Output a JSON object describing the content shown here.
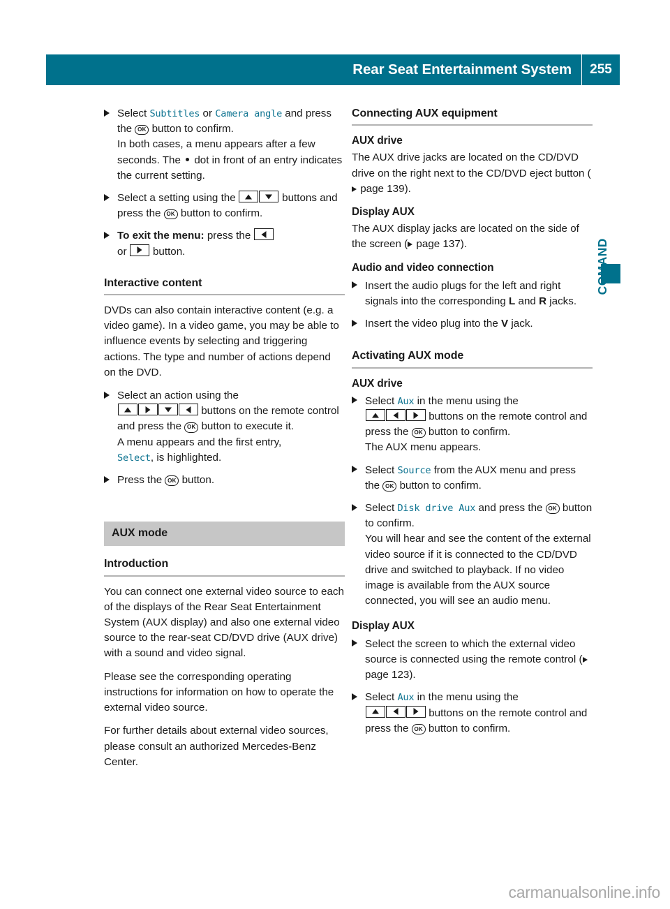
{
  "header": {
    "title": "Rear Seat Entertainment System",
    "page_number": "255"
  },
  "side_tab": {
    "label": "COMAND"
  },
  "watermark": {
    "text": "carmanualsonline.info"
  },
  "left_column": {
    "step_subtitles": {
      "lead": "Select ",
      "term1": "Subtitles",
      "mid": " or ",
      "term2": "Camera angle",
      "tail": " and press the ",
      "ok": "OK",
      "tail2": " button to confirm.",
      "cont1a": "In both cases, a menu appears after a few seconds. The ",
      "cont1b": " dot in front of an entry indicates the current setting."
    },
    "step_setting": {
      "lead": "Select a setting using the ",
      "mid": " buttons and press the ",
      "ok": "OK",
      "tail": " button to confirm."
    },
    "step_exit": {
      "bold": "To exit the menu:",
      "lead": " press the ",
      "mid": " or ",
      "tail": " button."
    },
    "interactive": {
      "heading": "Interactive content",
      "paragraph": "DVDs can also contain interactive content (e.g. a video game). In a video game, you may be able to influence events by selecting and triggering actions. The type and number of actions depend on the DVD.",
      "step_action": {
        "lead": "Select an action using the",
        "mid": " buttons on the remote control and press the ",
        "ok": "OK",
        "tail": " button to execute it.",
        "cont": "A menu appears and the first entry, ",
        "term": "Select",
        "cont2": ", is highlighted."
      },
      "step_press": {
        "lead": "Press the ",
        "ok": "OK",
        "tail": " button."
      }
    },
    "aux_mode": {
      "band_title": "AUX mode",
      "intro_heading": "Introduction",
      "paragraph1": "You can connect one external video source to each of the displays of the Rear Seat Entertainment System (AUX display) and also one external video source to the rear-seat CD/DVD drive (AUX drive) with a sound and video signal.",
      "paragraph2": "Please see the corresponding operating instructions for information on how to operate the external video source.",
      "paragraph3": "For further details about external video sources, please consult an authorized Mercedes-Benz Center."
    }
  },
  "right_column": {
    "connecting": {
      "heading": "Connecting AUX equipment",
      "aux_drive_heading": "AUX drive",
      "aux_drive_text_a": "The AUX drive jacks are located on the CD/DVD drive on the right next to the CD/DVD eject button (",
      "aux_drive_text_b": " page 139).",
      "display_aux_heading": "Display AUX",
      "display_aux_text_a": "The AUX display jacks are located on the side of the screen (",
      "display_aux_text_b": " page 137).",
      "av_heading": "Audio and video connection",
      "step_audio": {
        "lead": "Insert the audio plugs for the left and right signals into the corresponding ",
        "bold1": "L",
        "mid": " and ",
        "bold2": "R",
        "tail": " jacks."
      },
      "step_video": {
        "lead": "Insert the video plug into the ",
        "bold": "V",
        "tail": " jack."
      }
    },
    "activating": {
      "heading": "Activating AUX mode",
      "aux_drive_heading": "AUX drive",
      "step_select_aux": {
        "lead": "Select ",
        "term": "Aux",
        "mid": " in the menu using the",
        "mid2": " buttons on the remote control and press the ",
        "ok": "OK",
        "tail": " button to confirm.",
        "cont": "The AUX menu appears."
      },
      "step_source": {
        "lead": "Select ",
        "term": "Source",
        "mid": " from the AUX menu and press the ",
        "ok": "OK",
        "tail": " button to confirm."
      },
      "step_disk": {
        "lead": "Select ",
        "term": "Disk drive Aux",
        "mid": " and press the ",
        "ok": "OK",
        "tail": " button to confirm.",
        "cont": "You will hear and see the content of the external video source if it is connected to the CD/DVD drive and switched to playback. If no video image is available from the AUX source connected, you will see an audio menu."
      },
      "display_aux_heading": "Display AUX",
      "step_screen": {
        "lead": "Select the screen to which the external video source is connected using the remote control (",
        "tail": " page 123)."
      },
      "step_select_aux2": {
        "lead": "Select ",
        "term": "Aux",
        "mid": " in the menu using the",
        "mid2": " buttons on the remote control and press the ",
        "ok": "OK",
        "tail": " button to confirm."
      }
    }
  },
  "colors": {
    "brand_teal": "#00718c",
    "menu_term_teal": "#0f7491",
    "band_gray": "#c6c6c6"
  }
}
